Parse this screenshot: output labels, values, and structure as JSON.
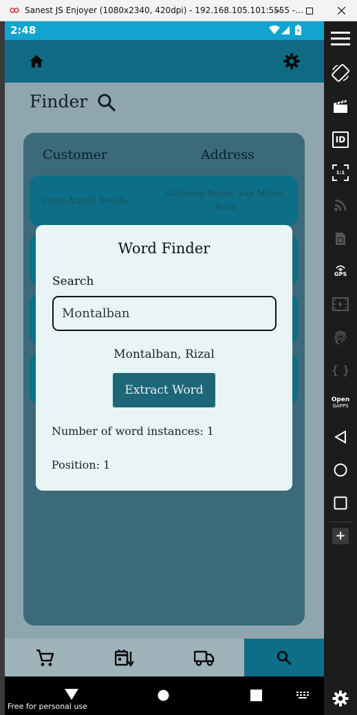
{
  "window": {
    "title": "Sanest JS Enjoyer (1080x2340, 420dpi) - 192.168.105.101:5555 -...",
    "minimize_label": "—",
    "maximize_label": "☐",
    "close_label": "✕"
  },
  "status": {
    "time": "2:48"
  },
  "page": {
    "title": "Finder"
  },
  "table": {
    "headers": [
      "Customer",
      "Address"
    ],
    "rows": [
      {
        "customer": "Vince Arnold Sevilla",
        "address": "Guitnang Bayan, San Mateo, Rizal"
      }
    ]
  },
  "modal": {
    "title": "Word Finder",
    "search_label": "Search",
    "search_value": "Montalban",
    "source_text": "Montalban, Rizal",
    "extract_button": "Extract Word",
    "instances_text": "Number of word instances: 1",
    "position_text": "Position: 1"
  },
  "bottom_nav": [
    "cart-icon",
    "calendar-sort-icon",
    "truck-icon",
    "search-icon"
  ],
  "bottom_nav_active": 3,
  "system_nav": {
    "watermark": "Free for personal use"
  },
  "toolbar": {
    "id_label": "ID",
    "ratio_label": "1:1",
    "gps_label": "GPS",
    "braces_label": "{ }",
    "opengapps_label_1": "Open",
    "opengapps_label_2": "GAPPS",
    "plus_label": "+"
  },
  "colors": {
    "status_bar": "#12a4cf",
    "app_bar": "#0f6b84",
    "card": "#3b6a7a",
    "row": "#0c6f87",
    "modal": "#e8f4f6",
    "button": "#1c6678"
  }
}
